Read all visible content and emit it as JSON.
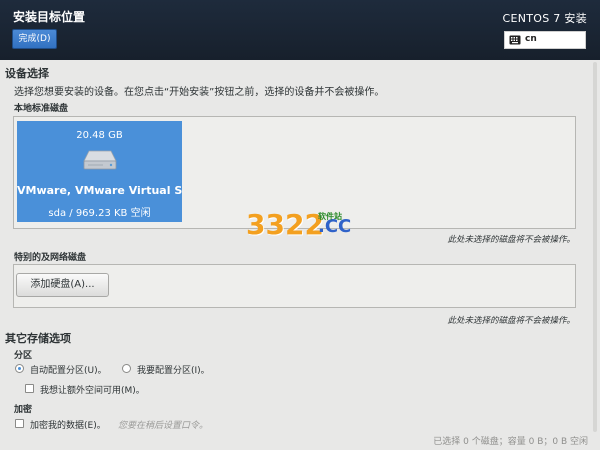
{
  "header": {
    "title": "安装目标位置",
    "done_label": "完成(D)",
    "product": "CENTOS 7 安装",
    "keyboard_layout": "cn",
    "keyboard_icon": "keyboard-icon"
  },
  "device_selection": {
    "title": "设备选择",
    "description": "选择您想要安装的设备。在您点击“开始安装”按钮之前，选择的设备并不会被操作。",
    "local_disks_label": "本地标准磁盘",
    "disk": {
      "size": "20.48 GB",
      "icon": "hard-disk-icon",
      "name": "VMware, VMware Virtual S",
      "info": "sda   /   969.23 KB 空闲",
      "selected": true,
      "color": "#4a90d9"
    },
    "local_note": "此处未选择的磁盘将不会被操作。",
    "network_disks_label": "特别的及网络磁盘",
    "add_disk_label": "添加硬盘(A)...",
    "network_note": "此处未选择的磁盘将不会被操作。"
  },
  "other_storage": {
    "title": "其它存储选项",
    "partition_label": "分区",
    "auto_partition": "自动配置分区(U)。",
    "manual_partition": "我要配置分区(I)。",
    "selected_option": "自动配置分区(U)。",
    "extra_space": "我想让额外空间可用(M)。",
    "encryption_label": "加密",
    "encrypt_data": "加密我的数据(E)。",
    "encrypt_hint": "您要在稍后设置口令。"
  },
  "summary": "已选择 0 个磁盘；容量 0 B；0 B 空闲",
  "watermark": {
    "digits": "3322",
    "domain": ".CC",
    "tag": "软件站"
  }
}
